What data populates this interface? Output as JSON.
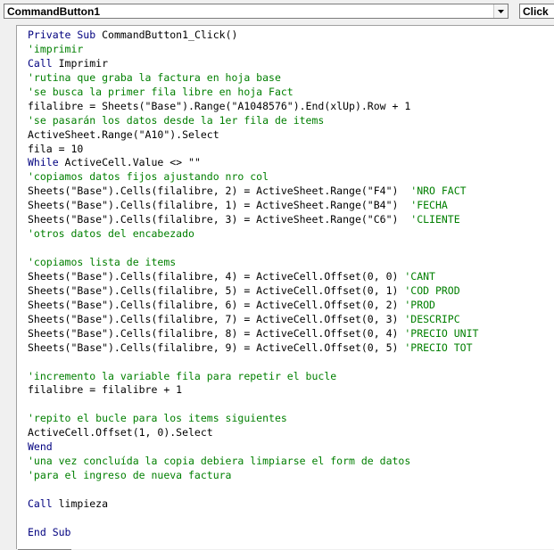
{
  "toolbar": {
    "object_combo": "CommandButton1",
    "procedure_combo": "Click"
  },
  "code_lines": [
    [
      {
        "t": "kw",
        "s": "Private Sub "
      },
      {
        "t": "n",
        "s": "CommandButton1_Click()"
      }
    ],
    [
      {
        "t": "cm",
        "s": "'imprimir"
      }
    ],
    [
      {
        "t": "kw",
        "s": "Call "
      },
      {
        "t": "n",
        "s": "Imprimir"
      }
    ],
    [
      {
        "t": "cm",
        "s": "'rutina que graba la factura en hoja base"
      }
    ],
    [
      {
        "t": "cm",
        "s": "'se busca la primer fila libre en hoja Fact"
      }
    ],
    [
      {
        "t": "n",
        "s": "filalibre = Sheets(\"Base\").Range(\"A1048576\").End(xlUp).Row + 1"
      }
    ],
    [
      {
        "t": "cm",
        "s": "'se pasarán los datos desde la 1er fila de items"
      }
    ],
    [
      {
        "t": "n",
        "s": "ActiveSheet.Range(\"A10\").Select"
      }
    ],
    [
      {
        "t": "n",
        "s": "fila = 10"
      }
    ],
    [
      {
        "t": "kw",
        "s": "While "
      },
      {
        "t": "n",
        "s": "ActiveCell.Value <> \"\""
      }
    ],
    [
      {
        "t": "cm",
        "s": "'copiamos datos fijos ajustando nro col"
      }
    ],
    [
      {
        "t": "n",
        "s": "Sheets(\"Base\").Cells(filalibre, 2) = ActiveSheet.Range(\"F4\")  "
      },
      {
        "t": "cm",
        "s": "'NRO FACT"
      }
    ],
    [
      {
        "t": "n",
        "s": "Sheets(\"Base\").Cells(filalibre, 1) = ActiveSheet.Range(\"B4\")  "
      },
      {
        "t": "cm",
        "s": "'FECHA"
      }
    ],
    [
      {
        "t": "n",
        "s": "Sheets(\"Base\").Cells(filalibre, 3) = ActiveSheet.Range(\"C6\")  "
      },
      {
        "t": "cm",
        "s": "'CLIENTE"
      }
    ],
    [
      {
        "t": "cm",
        "s": "'otros datos del encabezado"
      }
    ],
    [
      {
        "t": "n",
        "s": ""
      }
    ],
    [
      {
        "t": "cm",
        "s": "'copiamos lista de items"
      }
    ],
    [
      {
        "t": "n",
        "s": "Sheets(\"Base\").Cells(filalibre, 4) = ActiveCell.Offset(0, 0) "
      },
      {
        "t": "cm",
        "s": "'CANT"
      }
    ],
    [
      {
        "t": "n",
        "s": "Sheets(\"Base\").Cells(filalibre, 5) = ActiveCell.Offset(0, 1) "
      },
      {
        "t": "cm",
        "s": "'COD PROD"
      }
    ],
    [
      {
        "t": "n",
        "s": "Sheets(\"Base\").Cells(filalibre, 6) = ActiveCell.Offset(0, 2) "
      },
      {
        "t": "cm",
        "s": "'PROD"
      }
    ],
    [
      {
        "t": "n",
        "s": "Sheets(\"Base\").Cells(filalibre, 7) = ActiveCell.Offset(0, 3) "
      },
      {
        "t": "cm",
        "s": "'DESCRIPC"
      }
    ],
    [
      {
        "t": "n",
        "s": "Sheets(\"Base\").Cells(filalibre, 8) = ActiveCell.Offset(0, 4) "
      },
      {
        "t": "cm",
        "s": "'PRECIO UNIT"
      }
    ],
    [
      {
        "t": "n",
        "s": "Sheets(\"Base\").Cells(filalibre, 9) = ActiveCell.Offset(0, 5) "
      },
      {
        "t": "cm",
        "s": "'PRECIO TOT"
      }
    ],
    [
      {
        "t": "n",
        "s": ""
      }
    ],
    [
      {
        "t": "cm",
        "s": "'incremento la variable fila para repetir el bucle"
      }
    ],
    [
      {
        "t": "n",
        "s": "filalibre = filalibre + 1"
      }
    ],
    [
      {
        "t": "n",
        "s": ""
      }
    ],
    [
      {
        "t": "cm",
        "s": "'repito el bucle para los items siguientes"
      }
    ],
    [
      {
        "t": "n",
        "s": "ActiveCell.Offset(1, 0).Select"
      }
    ],
    [
      {
        "t": "kw",
        "s": "Wend"
      }
    ],
    [
      {
        "t": "cm",
        "s": "'una vez concluída la copia debiera limpiarse el form de datos"
      }
    ],
    [
      {
        "t": "cm",
        "s": "'para el ingreso de nueva factura"
      }
    ],
    [
      {
        "t": "n",
        "s": ""
      }
    ],
    [
      {
        "t": "kw",
        "s": "Call "
      },
      {
        "t": "n",
        "s": "limpieza"
      }
    ],
    [
      {
        "t": "n",
        "s": ""
      }
    ],
    [
      {
        "t": "kw",
        "s": "End Sub"
      }
    ]
  ],
  "colors": {
    "keyword": "#00007f",
    "comment": "#007f00",
    "text": "#000000"
  },
  "icons": {
    "dropdown": "chevron-down-icon"
  }
}
